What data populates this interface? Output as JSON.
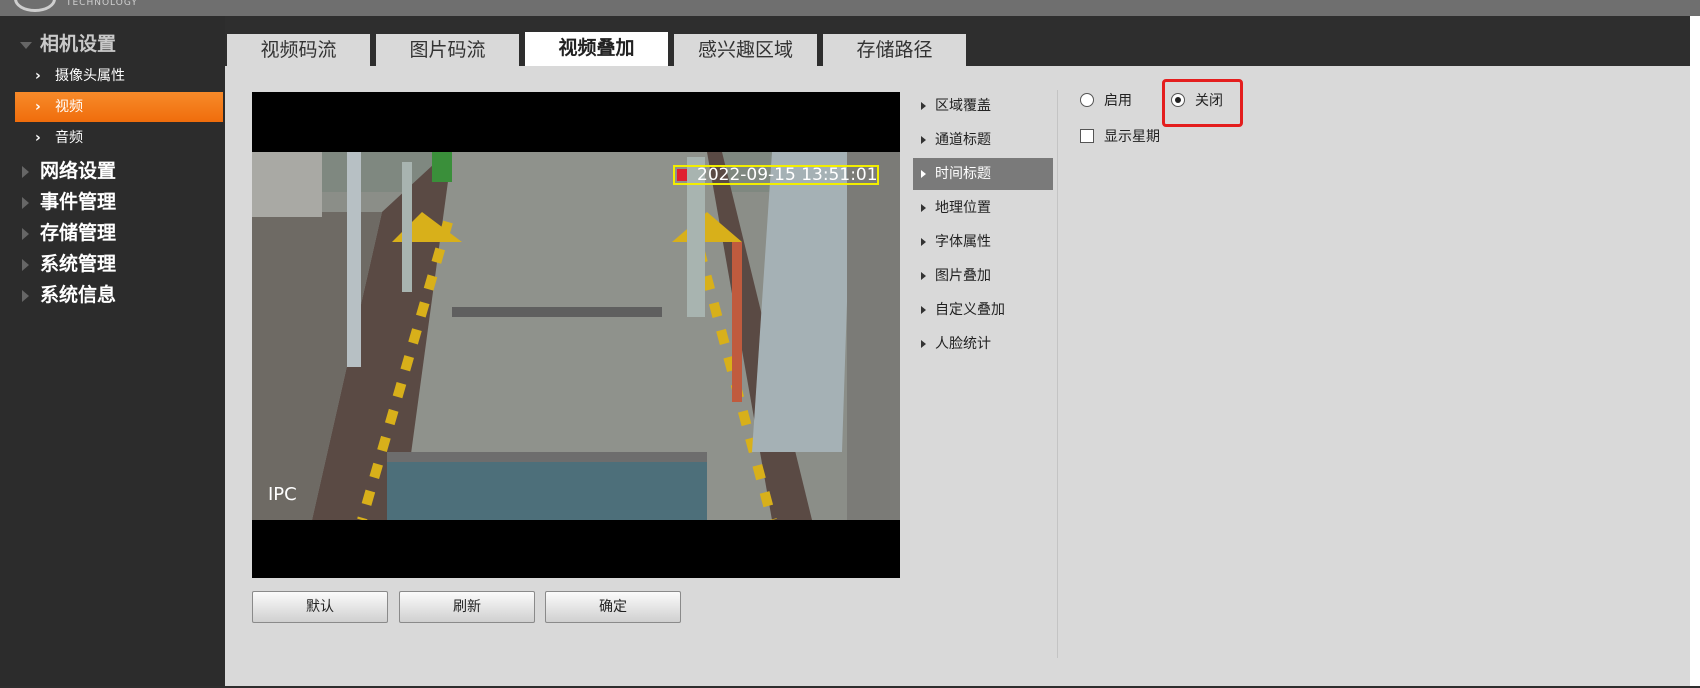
{
  "header": {
    "logo_text": "TECHNOLOGY"
  },
  "sidebar": {
    "groups": [
      {
        "label": "相机设置",
        "expanded": true
      },
      {
        "label": "网络设置"
      },
      {
        "label": "事件管理"
      },
      {
        "label": "存储管理"
      },
      {
        "label": "系统管理"
      },
      {
        "label": "系统信息"
      }
    ],
    "sub_items": [
      {
        "label": "摄像头属性"
      },
      {
        "label": "视频",
        "active": true
      },
      {
        "label": "音频"
      }
    ]
  },
  "tabs": [
    {
      "label": "视频码流"
    },
    {
      "label": "图片码流"
    },
    {
      "label": "视频叠加",
      "active": true
    },
    {
      "label": "感兴趣区域"
    },
    {
      "label": "存储路径"
    }
  ],
  "preview": {
    "osd_timestamp": "2022-09-15 13:51:01",
    "channel_label": "IPC"
  },
  "buttons": {
    "default": "默认",
    "refresh": "刷新",
    "confirm": "确定"
  },
  "overlay_menu": [
    {
      "label": "区域覆盖"
    },
    {
      "label": "通道标题"
    },
    {
      "label": "时间标题",
      "active": true
    },
    {
      "label": "地理位置"
    },
    {
      "label": "字体属性"
    },
    {
      "label": "图片叠加"
    },
    {
      "label": "自定义叠加"
    },
    {
      "label": "人脸统计"
    }
  ],
  "time_title": {
    "enable_label": "启用",
    "disable_label": "关闭",
    "selected": "关闭",
    "show_week_label": "显示星期",
    "show_week_checked": false
  },
  "colors": {
    "accent": "#f47a1f",
    "highlight_border": "#e41e1e",
    "osd_box": "#f2ee00",
    "sidebar_bg": "#2c2c2c",
    "content_bg": "#d9d9d9"
  }
}
